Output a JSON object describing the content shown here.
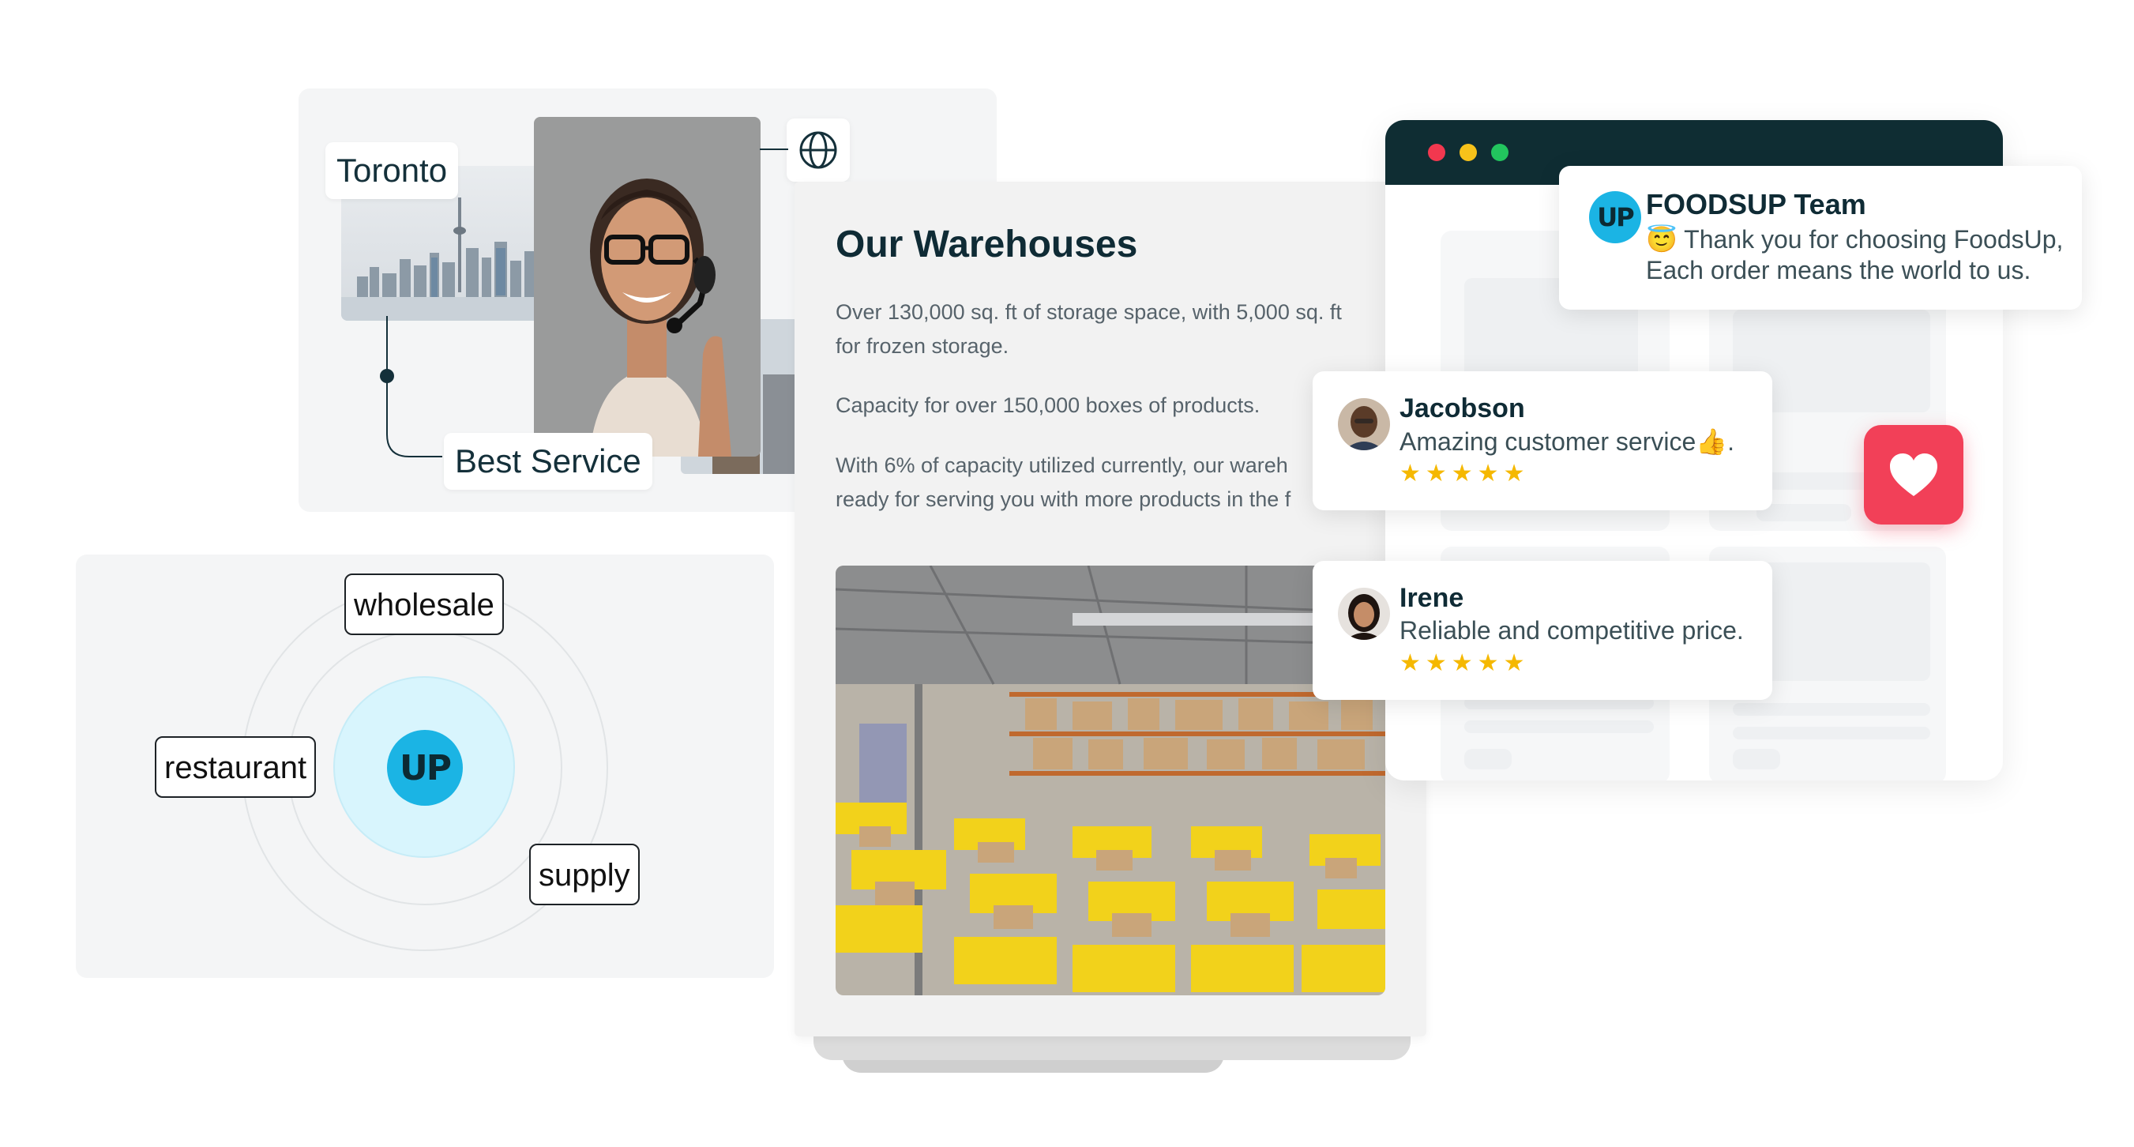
{
  "service_card": {
    "city_tag": "Toronto",
    "service_tag": "Best Service",
    "globe_icon": "globe-icon"
  },
  "segments": {
    "top": "wholesale",
    "left": "restaurant",
    "right": "supply",
    "logo": "UP"
  },
  "warehouse": {
    "title": "Our Warehouses",
    "line1": "Over 130,000 sq. ft of storage space, with 5,000 sq. ft",
    "line2": "for frozen storage.",
    "line3": "Capacity for over 150,000 boxes of products.",
    "line4": "With 6% of capacity utilized currently, our wareh",
    "line5": "ready for serving you with more products in the f"
  },
  "browser": {
    "dots": [
      "#f2384f",
      "#f7c21a",
      "#22c55e"
    ]
  },
  "team_toast": {
    "logo": "UP",
    "title": "FOODSUP Team",
    "line1": "😇 Thank you for choosing FoodsUp,",
    "line2": "Each order means the world to us."
  },
  "reviews": [
    {
      "name": "Jacobson",
      "text": "Amazing customer service👍.",
      "stars": "★★★★★",
      "rating": 5
    },
    {
      "name": "Irene",
      "text": "Reliable and competitive price.",
      "stars": "★★★★★",
      "rating": 5
    }
  ],
  "heart": {
    "icon": "heart-icon",
    "color": "#f24058"
  },
  "colors": {
    "brand_blue": "#1bb4e4",
    "dark_teal": "#0f2d33",
    "star": "#f5b800"
  }
}
